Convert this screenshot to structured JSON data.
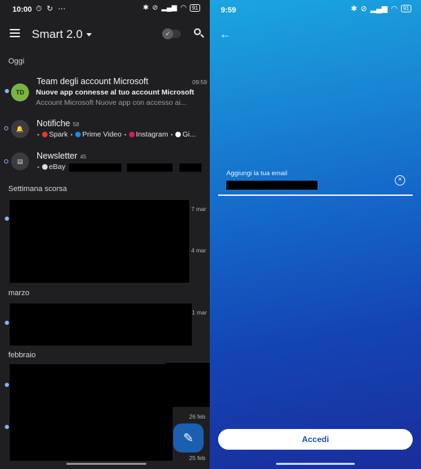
{
  "left": {
    "status": {
      "time": "10:00",
      "left_icons": "⏱ ↻ ⋯",
      "battery": "91"
    },
    "appbar": {
      "title": "Smart 2.0"
    },
    "sections": {
      "today": "Oggi",
      "last_week": "Settimana scorsa",
      "march": "marzo",
      "february": "febbraio"
    },
    "messages": [
      {
        "initials": "TD",
        "sender": "Team degli account Microsoft",
        "time": "09:59",
        "subject": "Nuove app connesse al tuo account Microsoft",
        "preview": "Account Microsoft Nuove app con accesso ai..."
      },
      {
        "sender": "Notifiche",
        "count": "58",
        "chips": [
          "Spark",
          "Prime Video",
          "Instagram",
          "Gi..."
        ]
      },
      {
        "sender": "Newsletter",
        "count": "45",
        "chips": [
          "eBay"
        ]
      }
    ],
    "dates": [
      "7 mar",
      "4 mar",
      "1 mar",
      "26 feb",
      "25 feb"
    ],
    "colors": {
      "avatar_td": "#7cb342",
      "unread_dot": "#8ab4f8",
      "fab": "#1c5fb0"
    }
  },
  "right": {
    "status": {
      "time": "9:59",
      "battery": "91"
    },
    "email_label": "Aggiungi la tua email",
    "submit_label": "Accedi",
    "colors": {
      "gradient_top": "#1aa6e0",
      "gradient_bottom": "#1a2d9c",
      "button_text": "#1f4fb0"
    }
  }
}
